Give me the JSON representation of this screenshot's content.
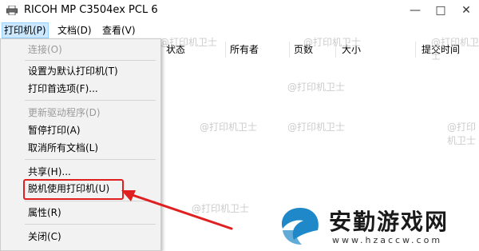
{
  "window": {
    "title": "RICOH MP C3504ex PCL 6",
    "minimize_glyph": "—",
    "maximize_glyph": "□",
    "close_glyph": "✕"
  },
  "menubar": {
    "items": [
      {
        "label": "打印机(P)"
      },
      {
        "label": "文档(D)"
      },
      {
        "label": "查看(V)"
      }
    ]
  },
  "columns": [
    {
      "label": "状态"
    },
    {
      "label": "所有者"
    },
    {
      "label": "页数"
    },
    {
      "label": "大小"
    },
    {
      "label": "提交时间"
    }
  ],
  "dropdown": {
    "items": [
      {
        "label": "连接(O)",
        "disabled": true
      },
      {
        "label": "设置为默认打印机(T)",
        "disabled": false
      },
      {
        "label": "打印首选项(F)...",
        "disabled": false
      },
      {
        "label": "更新驱动程序(D)",
        "disabled": true
      },
      {
        "label": "暂停打印(A)",
        "disabled": false
      },
      {
        "label": "取消所有文档(L)",
        "disabled": false
      },
      {
        "label": "共享(H)...",
        "disabled": false
      },
      {
        "label": "脱机使用打印机(U)",
        "disabled": false,
        "highlighted": true
      },
      {
        "label": "属性(R)",
        "disabled": false
      },
      {
        "label": "关闭(C)",
        "disabled": false
      }
    ]
  },
  "watermark": {
    "text": "@打印机卫士"
  },
  "logo": {
    "title": "安勤游戏网",
    "url": "www.hzaccw.com"
  },
  "colors": {
    "highlight": "#e02020",
    "menu_active_bg": "#cce8ff",
    "logo_blue": "#1e88c8"
  }
}
